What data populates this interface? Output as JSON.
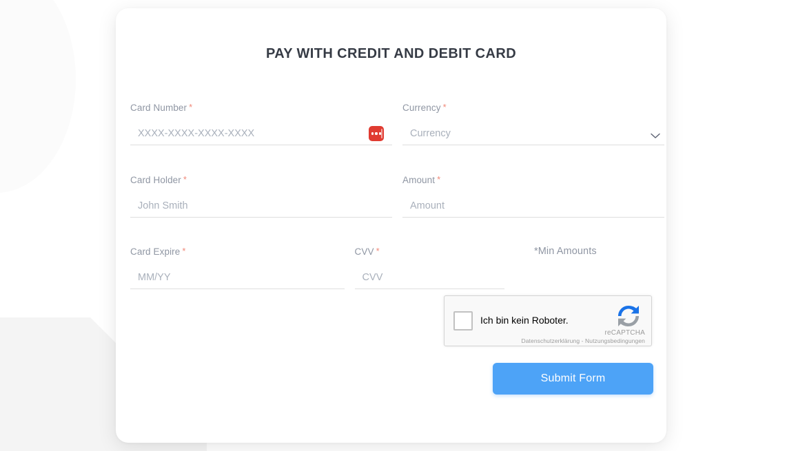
{
  "page": {
    "title": "PAY WITH CREDIT AND DEBIT CARD"
  },
  "colors": {
    "accent": "#4da3f7",
    "required_asterisk": "#f08878",
    "label": "#8f96a3",
    "placeholder": "#a9b0bb",
    "password_badge": "#e03b31",
    "card_background": "#ffffff",
    "page_background": "#ffffff",
    "decorative_shape": "#f4f4f4",
    "underline": "#dedede"
  },
  "form": {
    "fields": {
      "card_number": {
        "label": "Card Number",
        "required_mark": "*",
        "placeholder": "XXXX-XXXX-XXXX-XXXX",
        "value": ""
      },
      "currency": {
        "label": "Currency",
        "required_mark": "*",
        "selected": "Currency",
        "options": [
          "Currency"
        ]
      },
      "card_holder": {
        "label": "Card Holder",
        "required_mark": "*",
        "placeholder": "John Smith",
        "value": ""
      },
      "amount": {
        "label": "Amount",
        "required_mark": "*",
        "placeholder": "Amount",
        "value": ""
      },
      "card_expire": {
        "label": "Card Expire",
        "required_mark": "*",
        "placeholder": "MM/YY",
        "value": ""
      },
      "cvv": {
        "label": "CVV",
        "required_mark": "*",
        "placeholder": "CVV",
        "value": ""
      }
    },
    "min_amounts_note": "*Min Amounts",
    "submit_label": "Submit Form"
  },
  "recaptcha": {
    "checkbox_label": "Ich bin kein Roboter.",
    "brand": "reCAPTCHA",
    "privacy_link": "Datenschutzerklärung",
    "separator": "-",
    "terms_link": "Nutzungsbedingungen",
    "checked": false
  },
  "icons": {
    "password_manager": "password-manager-icon",
    "chevron_down": "chevron-down-icon",
    "recaptcha_logo": "recaptcha-logo-icon"
  }
}
